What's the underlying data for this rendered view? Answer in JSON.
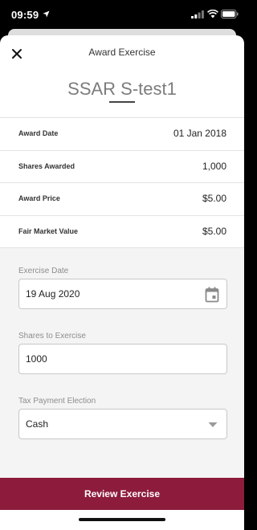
{
  "status_bar": {
    "time": "09:59"
  },
  "header": {
    "title": "Award Exercise",
    "award_name": "SSAR S-test1"
  },
  "details": [
    {
      "label": "Award Date",
      "value": "01 Jan 2018"
    },
    {
      "label": "Shares Awarded",
      "value": "1,000"
    },
    {
      "label": "Award Price",
      "value": "$5.00"
    },
    {
      "label": "Fair Market Value",
      "value": "$5.00"
    }
  ],
  "form": {
    "exercise_date": {
      "label": "Exercise Date",
      "value": "19 Aug 2020"
    },
    "shares_to_exercise": {
      "label": "Shares to Exercise",
      "value": "1000"
    },
    "tax_payment_election": {
      "label": "Tax Payment Election",
      "value": "Cash"
    }
  },
  "review_button": {
    "label": "Review Exercise"
  },
  "colors": {
    "accent": "#8d1b3c",
    "form_background": "#f4f4f4"
  }
}
